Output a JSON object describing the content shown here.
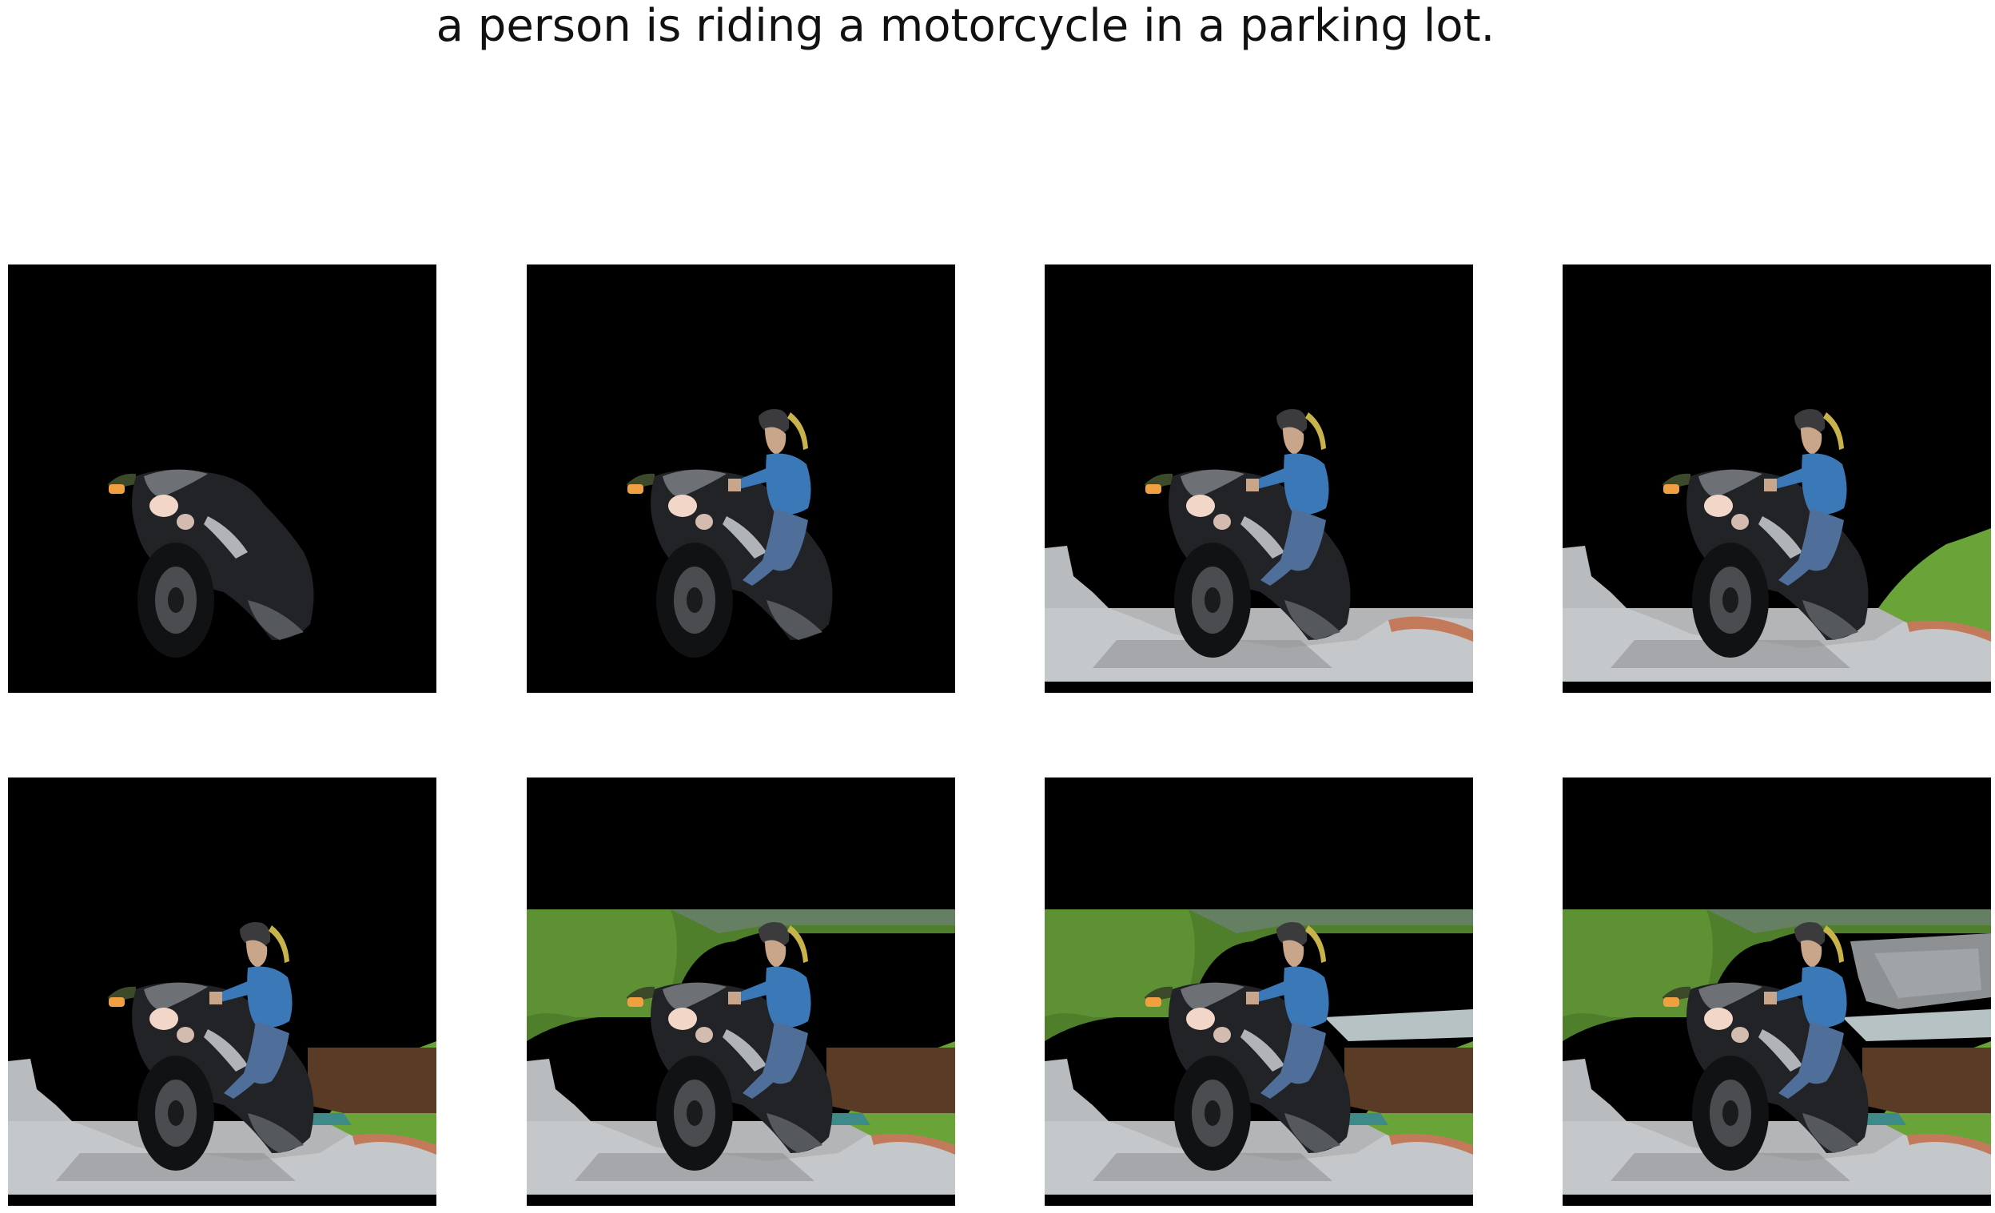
{
  "caption": "a person is riding a motorcycle in a parking lot.",
  "colors": {
    "background": "#000000",
    "road": "#b9bcbf",
    "grass": "#6aa338",
    "trees": "#4f7f2a",
    "brick": "#c27a5a",
    "mulch": "#5a3b26",
    "shirt": "#3a78b8",
    "jeans": "#4f6f9a",
    "bike": "#222326",
    "headlight": "#f2d6c8",
    "indicator": "#f0a040"
  },
  "panels": [
    {
      "id": 1,
      "layers": [
        "bike"
      ]
    },
    {
      "id": 2,
      "layers": [
        "bike",
        "rider"
      ]
    },
    {
      "id": 3,
      "layers": [
        "road-left",
        "road",
        "brick",
        "bike",
        "rider"
      ]
    },
    {
      "id": 4,
      "layers": [
        "road-left",
        "road",
        "brick",
        "grass",
        "bike",
        "rider"
      ]
    },
    {
      "id": 5,
      "layers": [
        "road-left",
        "road",
        "brick",
        "grass",
        "mulch",
        "bike",
        "rider"
      ]
    },
    {
      "id": 6,
      "layers": [
        "trees",
        "road-left",
        "road",
        "brick",
        "grass",
        "mulch",
        "bike",
        "rider"
      ]
    },
    {
      "id": 7,
      "layers": [
        "trees",
        "road-left",
        "road",
        "brick",
        "grass",
        "mulch",
        "wall",
        "bike",
        "rider"
      ]
    },
    {
      "id": 8,
      "layers": [
        "trees",
        "road-left",
        "road",
        "brick",
        "grass",
        "mulch",
        "wall",
        "texture",
        "bike",
        "rider"
      ]
    }
  ]
}
